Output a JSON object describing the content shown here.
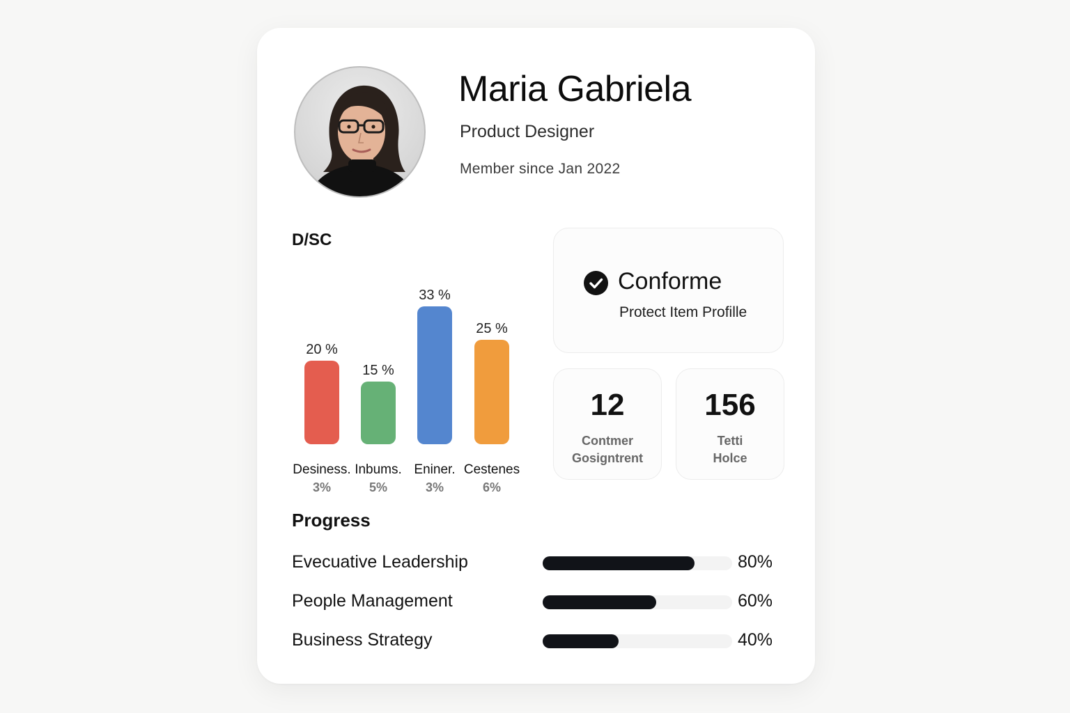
{
  "profile": {
    "name": "Maria Gabriela",
    "role": "Product Designer",
    "member_since": "Member since Jan 2022"
  },
  "chart_data": {
    "type": "bar",
    "title": "D/SC",
    "categories": [
      "Desiness.",
      "Inbums.",
      "Eniner.",
      "Cestenes"
    ],
    "values": [
      20,
      15,
      33,
      25
    ],
    "value_labels": [
      "20 %",
      "15 %",
      "33 %",
      "25 %"
    ],
    "sub_labels": [
      "3%",
      "5%",
      "3%",
      "6%"
    ],
    "colors": [
      "#e45d4f",
      "#66b176",
      "#5486cf",
      "#f09c3d"
    ],
    "ylim": [
      0,
      33
    ],
    "grid": false
  },
  "status": {
    "title": "Conforme",
    "subtitle": "Protect Item Profille",
    "icon": "check-circle-icon"
  },
  "stats": [
    {
      "value": "12",
      "label_line1": "Contmer",
      "label_line2": "Gosigntrent"
    },
    {
      "value": "156",
      "label_line1": "Tetti",
      "label_line2": "Holce"
    }
  ],
  "progress": {
    "title": "Progress",
    "items": [
      {
        "label": "Evecuative Leadership",
        "value": 80,
        "value_label": "80%"
      },
      {
        "label": "People Management",
        "value": 60,
        "value_label": "60%"
      },
      {
        "label": "Business Strategy",
        "value": 40,
        "value_label": "40%"
      }
    ]
  }
}
